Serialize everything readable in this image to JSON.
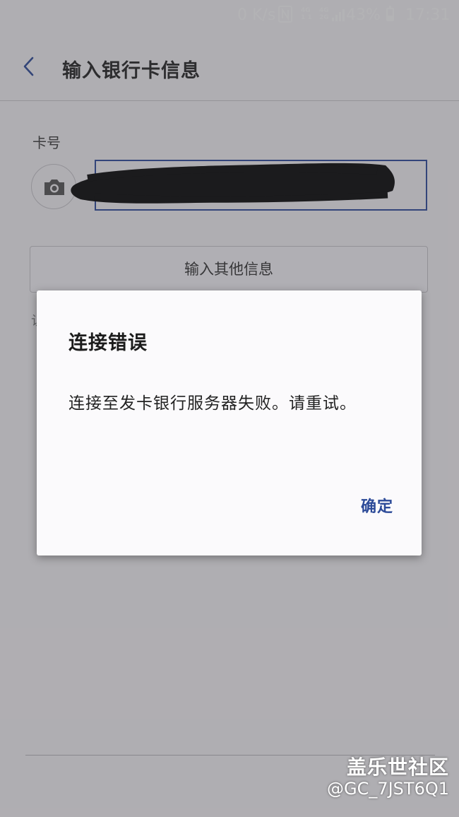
{
  "status_bar": {
    "net_speed": "0 K/s",
    "nfc_icon": "nfc-icon",
    "network_1": [
      "4G",
      "1 1"
    ],
    "network_2": [
      "4G",
      "2G"
    ],
    "signal_icon": "signal-icon",
    "battery_percent": "43%",
    "battery_level": 0.43,
    "time": "17:31"
  },
  "header": {
    "back_icon": "chevron-left-icon",
    "title": "输入银行卡信息"
  },
  "form": {
    "card_number_label": "卡号",
    "camera_icon": "camera-icon",
    "card_number_value": "",
    "other_info_button": "输入其他信息",
    "peek_text": "认",
    "accent_color": "#2d4a9b"
  },
  "dialog": {
    "title": "连接错误",
    "message": "连接至发卡银行服务器失败。请重试。",
    "confirm_label": "确定",
    "confirm_color": "#2c4a98"
  },
  "watermark": {
    "site": "盖乐世社区",
    "user": "@GC_7JST6Q1"
  }
}
